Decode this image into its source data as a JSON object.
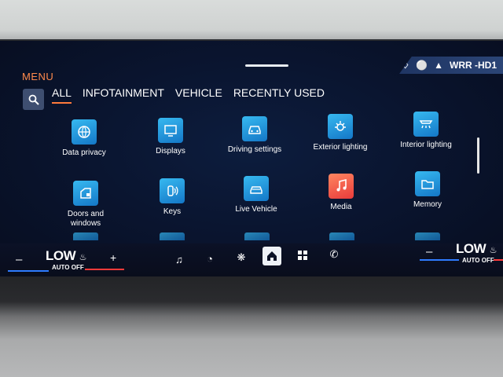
{
  "status_bar": {
    "station": "WRR -HD1",
    "icons": [
      "bell-icon",
      "mic-muted-icon",
      "signal-icon"
    ]
  },
  "menu": {
    "title": "MENU"
  },
  "tabs": [
    {
      "label": "ALL",
      "active": true
    },
    {
      "label": "INFOTAINMENT",
      "active": false
    },
    {
      "label": "VEHICLE",
      "active": false
    },
    {
      "label": "RECENTLY USED",
      "active": false
    }
  ],
  "apps": [
    {
      "label": "Data privacy",
      "icon": "data-privacy-icon"
    },
    {
      "label": "Displays",
      "icon": "displays-icon"
    },
    {
      "label": "Driving settings",
      "icon": "driving-settings-icon"
    },
    {
      "label": "Exterior lighting",
      "icon": "exterior-lighting-icon"
    },
    {
      "label": "Interior lighting",
      "icon": "interior-lighting-icon"
    },
    {
      "label": "Doors and windows",
      "icon": "doors-windows-icon"
    },
    {
      "label": "Keys",
      "icon": "keys-icon"
    },
    {
      "label": "Live Vehicle",
      "icon": "live-vehicle-icon"
    },
    {
      "label": "Media",
      "icon": "media-icon"
    },
    {
      "label": "Memory",
      "icon": "memory-icon"
    }
  ],
  "climate_left": {
    "minus": "–",
    "level": "LOW",
    "mode": "AUTO OFF",
    "plus": "+"
  },
  "climate_right": {
    "minus": "–",
    "level": "LOW",
    "mode": "AUTO OFF"
  },
  "nav": [
    "music-note-icon",
    "speedometer-icon",
    "fan-icon",
    "home-icon",
    "apps-grid-icon",
    "phone-icon"
  ],
  "colors": {
    "accent": "#ff7a3c",
    "tile": "#1f8fdc",
    "media_tile": "#f05a48",
    "temp_cold": "#2e7bff",
    "temp_hot": "#ff3a3a"
  }
}
